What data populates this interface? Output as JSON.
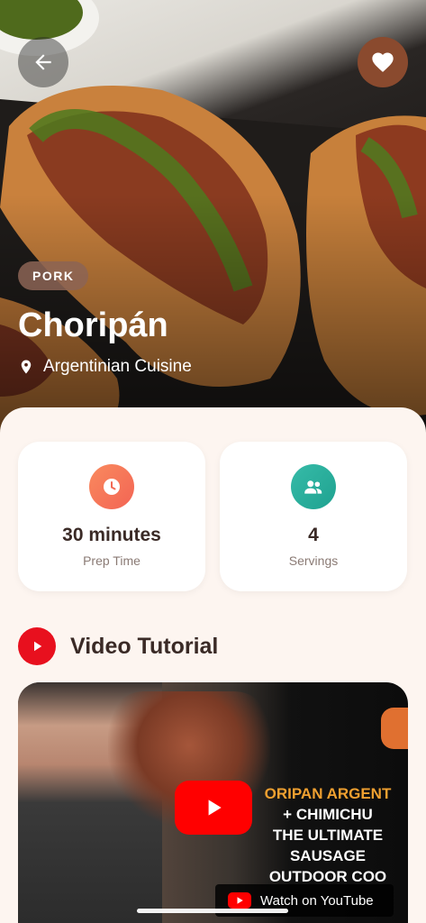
{
  "recipe": {
    "category": "PORK",
    "title": "Choripán",
    "cuisine": "Argentinian Cuisine"
  },
  "stats": [
    {
      "value": "30 minutes",
      "label": "Prep Time",
      "icon": "clock-icon",
      "color": "#F7735A"
    },
    {
      "value": "4",
      "label": "Servings",
      "icon": "people-icon",
      "color": "#2BAE9C"
    }
  ],
  "video": {
    "section_title": "Video Tutorial",
    "overlay_lines": [
      "ORIPAN ARGENT",
      "+ CHIMICHU",
      "THE ULTIMATE",
      "SAUSAGE",
      "OUTDOOR COO"
    ],
    "watch_label": "Watch on YouTube"
  },
  "colors": {
    "accent": "#8A4A2E",
    "youtube_red": "#FF0000",
    "text_dark": "#3A2A26",
    "background": "#FDF5F0"
  }
}
